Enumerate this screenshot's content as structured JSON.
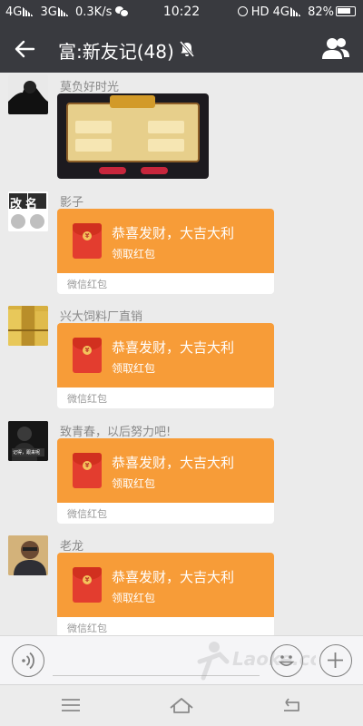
{
  "status_bar": {
    "left_network_1": "4G",
    "left_network_2": "3G",
    "speed": "0.3K/s",
    "time": "10:22",
    "right_network": "HD 4G",
    "battery": "82%",
    "icons": [
      "signal-icon",
      "wechat-icon",
      "alarm-icon",
      "battery-icon"
    ]
  },
  "header": {
    "title": "富:新友记(48)",
    "icons": [
      "back-arrow-icon",
      "mute-icon",
      "group-members-icon"
    ]
  },
  "messages": [
    {
      "sender": "莫负好时光",
      "type": "image",
      "image_desc": "game-screenshot"
    },
    {
      "sender": "影子",
      "type": "red_packet",
      "title": "恭喜发财，大吉大利",
      "action": "领取红包",
      "footer": "微信红包"
    },
    {
      "sender": "兴大饲料厂直销",
      "type": "red_packet",
      "title": "恭喜发财，大吉大利",
      "action": "领取红包",
      "footer": "微信红包"
    },
    {
      "sender": "致青春，以后努力吧!",
      "type": "red_packet",
      "title": "恭喜发财，大吉大利",
      "action": "领取红包",
      "footer": "微信红包"
    },
    {
      "sender": "老龙",
      "type": "red_packet",
      "title": "恭喜发财，大吉大利",
      "action": "领取红包",
      "footer": "微信红包"
    }
  ],
  "avatars": {
    "a2_text": "改名",
    "a4_text": "记得，跟来呢"
  },
  "input_bar": {
    "icons": [
      "voice-icon",
      "emoji-icon",
      "plus-icon"
    ],
    "watermark": "Laoke.com"
  },
  "nav_bar": {
    "icons": [
      "menu-icon",
      "home-icon",
      "back-icon"
    ]
  },
  "colors": {
    "header_bg": "#393a3f",
    "chat_bg": "#ebebeb",
    "red_packet": "#f79c38",
    "red_packet_icon": "#e33d2f"
  }
}
